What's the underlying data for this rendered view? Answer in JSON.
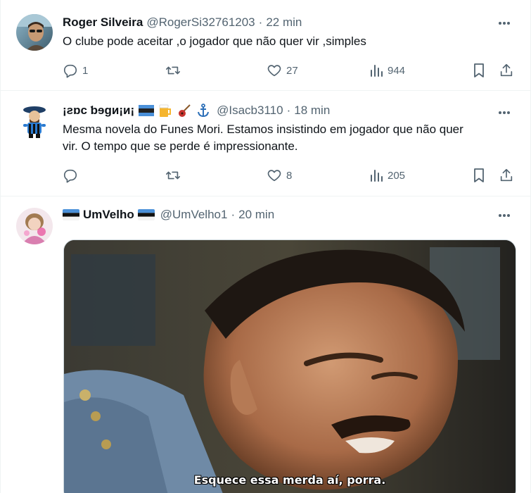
{
  "tweets": [
    {
      "name": "Roger Silveira",
      "handle": "@RogerSi32761203",
      "separator": "·",
      "time": "22 min",
      "text": "O clube pode aceitar ,o jogador que não quer vir ,simples",
      "replies": "1",
      "retweets": "",
      "likes": "27",
      "views": "944"
    },
    {
      "name": "¡ƨɒc ƅɘgᴎ¡ᴎ¡",
      "handle": "@Isacb3110",
      "separator": "·",
      "time": "18 min",
      "text_line1": "Mesma novela do Funes Mori. Estamos insistindo em jogador que não quer",
      "text_line2": "vir. O tempo que se perde é impressionante.",
      "replies": "",
      "retweets": "",
      "likes": "8",
      "views": "205"
    },
    {
      "name": "UmVelho",
      "handle": "@UmVelho1",
      "separator": "·",
      "time": "20 min",
      "media_subtitle": "Esquece essa merda aí, porra."
    }
  ],
  "icons": {
    "more": "more-horizontal-icon",
    "reply": "reply-icon",
    "retweet": "retweet-icon",
    "like": "heart-icon",
    "views": "views-chart-icon",
    "bookmark": "bookmark-icon",
    "share": "share-icon"
  },
  "colors": {
    "text": "#0f1419",
    "secondary": "#536471",
    "border": "#eff3f4"
  }
}
